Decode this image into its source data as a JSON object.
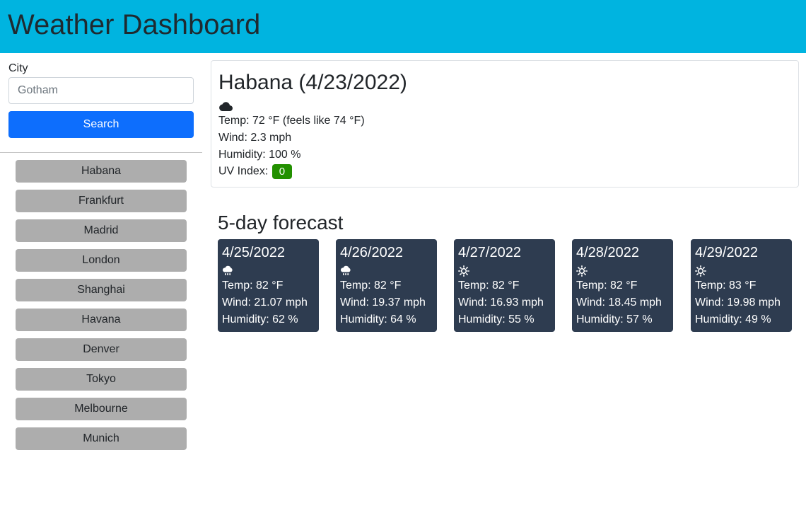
{
  "header": {
    "title": "Weather Dashboard"
  },
  "search": {
    "label": "City",
    "placeholder": "Gotham",
    "button_label": "Search"
  },
  "history": [
    "Habana",
    "Frankfurt",
    "Madrid",
    "London",
    "Shanghai",
    "Havana",
    "Denver",
    "Tokyo",
    "Melbourne",
    "Munich"
  ],
  "current": {
    "heading": "Habana (4/23/2022)",
    "icon": "cloud-icon",
    "temp": "Temp: 72 °F (feels like 74 °F)",
    "wind": "Wind: 2.3 mph",
    "humidity": "Humidity: 100 %",
    "uv_label": "UV Index:",
    "uv_value": "0",
    "uv_color": "#229000"
  },
  "forecast": {
    "title": "5-day forecast",
    "days": [
      {
        "date": "4/25/2022",
        "icon": "rain-cloud-icon",
        "temp": "Temp: 82 °F",
        "wind": "Wind: 21.07 mph",
        "humidity": "Humidity: 62 %"
      },
      {
        "date": "4/26/2022",
        "icon": "rain-cloud-icon",
        "temp": "Temp: 82 °F",
        "wind": "Wind: 19.37 mph",
        "humidity": "Humidity: 64 %"
      },
      {
        "date": "4/27/2022",
        "icon": "sun-icon",
        "temp": "Temp: 82 °F",
        "wind": "Wind: 16.93 mph",
        "humidity": "Humidity: 55 %"
      },
      {
        "date": "4/28/2022",
        "icon": "sun-icon",
        "temp": "Temp: 82 °F",
        "wind": "Wind: 18.45 mph",
        "humidity": "Humidity: 57 %"
      },
      {
        "date": "4/29/2022",
        "icon": "sun-icon",
        "temp": "Temp: 83 °F",
        "wind": "Wind: 19.98 mph",
        "humidity": "Humidity: 49 %"
      }
    ]
  },
  "colors": {
    "header_bg": "#00b4e0",
    "search_button": "#0d6efd",
    "history_button": "#adadad",
    "forecast_card": "#2e3c50",
    "uv_low": "#229000"
  }
}
